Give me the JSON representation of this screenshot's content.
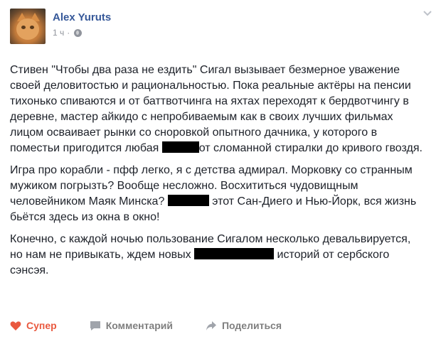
{
  "post": {
    "author": "Alex Yuruts",
    "time": "1 ч",
    "paragraphs": {
      "p1_a": "Стивен \"Чтобы два раза не ездить\" Сигал вызывает безмерное уважение своей деловитостью и рациональностью. Пока реальные актёры на пенсии тихонько спиваются и от баттвотчинга на яхтах переходят к бердвотчингу в деревне, мастер айкидо с непробиваемым как в своих лучших фильмах лицом осваивает рынки со сноровкой опытного дачника, у которого в поместьи пригодится любая",
      "p1_b": "от сломанной стиралки до кривого гвоздя.",
      "p2_a": "Игра про корабли - пфф легко, я с детства адмирал. Морковку со странным мужиком погрызть? Вообще несложно. Восхититься чудовищным человейником Маяк Минска?",
      "p2_b": "этот Сан-Диего и Нью-Йорк, вся жизнь бьётся здесь из окна в окно!",
      "p3_a": "Конечно, с каждой ночью пользование Сигалом несколько девальвируется, но нам не привыкать, ждем новых",
      "p3_b": "историй от сербского сэнсэя."
    }
  },
  "actions": {
    "like_label": "Супер",
    "comment_label": "Комментарий",
    "share_label": "Поделиться"
  },
  "colors": {
    "author": "#365899",
    "like": "#e9593f",
    "muted": "#90949c",
    "text": "#1d2129",
    "redaction": "#000000"
  },
  "icons": {
    "privacy": "globe-icon",
    "menu": "chevron-down-icon",
    "like": "heart-icon",
    "comment": "comment-icon",
    "share": "share-icon"
  }
}
